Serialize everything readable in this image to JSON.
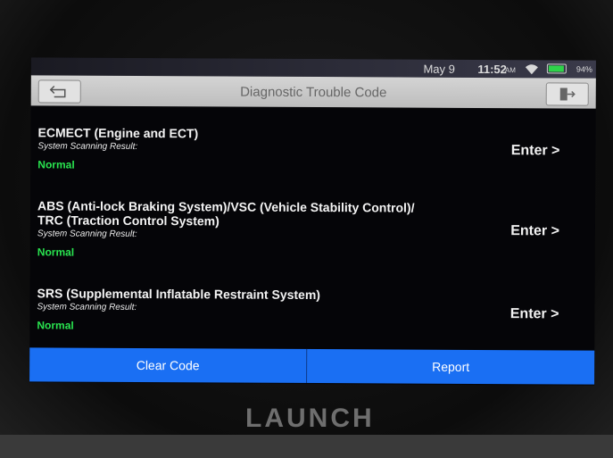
{
  "status": {
    "date": "May 9",
    "time": "11:52",
    "ampm": "AM",
    "battery_percent": 94,
    "battery_label": "94%"
  },
  "header": {
    "title": "Diagnostic Trouble Code",
    "back_icon": "back-arrow-icon",
    "exit_icon": "exit-icon"
  },
  "systems": [
    {
      "name_line1": "ECMECT (Engine and ECT)",
      "name_line2": "",
      "scan_label": "System Scanning Result:",
      "status": "Normal",
      "enter_label": "Enter >"
    },
    {
      "name_line1": "ABS (Anti-lock Braking System)/VSC (Vehicle Stability Control)/",
      "name_line2": "TRC (Traction Control System)",
      "scan_label": "System Scanning Result:",
      "status": "Normal",
      "enter_label": "Enter >"
    },
    {
      "name_line1": "SRS (Supplemental Inflatable Restraint System)",
      "name_line2": "",
      "scan_label": "System Scanning Result:",
      "status": "Normal",
      "enter_label": "Enter >"
    }
  ],
  "footer": {
    "clear_label": "Clear Code",
    "report_label": "Report"
  },
  "brand": "LAUNCH",
  "colors": {
    "accent": "#1a6ff3",
    "status_ok": "#29e34f"
  }
}
